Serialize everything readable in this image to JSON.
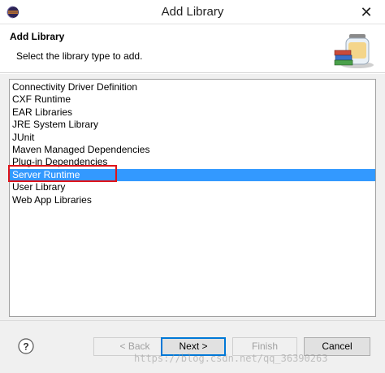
{
  "window": {
    "title": "Add Library",
    "app_icon": "eclipse-icon",
    "close_glyph": "✕"
  },
  "header": {
    "title": "Add Library",
    "description": "Select the library type to add.",
    "icon": "library-jars-icon"
  },
  "library_list": {
    "items": [
      "Connectivity Driver Definition",
      "CXF Runtime",
      "EAR Libraries",
      "JRE System Library",
      "JUnit",
      "Maven Managed Dependencies",
      "Plug-in Dependencies",
      "Server Runtime",
      "User Library",
      "Web App Libraries"
    ],
    "selected": "Server Runtime"
  },
  "buttons": {
    "help_glyph": "?",
    "back": "< Back",
    "next": "Next >",
    "finish": "Finish",
    "cancel": "Cancel"
  },
  "watermark": "https://blog.csdn.net/qq_36390263",
  "colors": {
    "selection": "#3399ff",
    "highlight_border": "#e0141a",
    "default_button_border": "#0078d7"
  }
}
